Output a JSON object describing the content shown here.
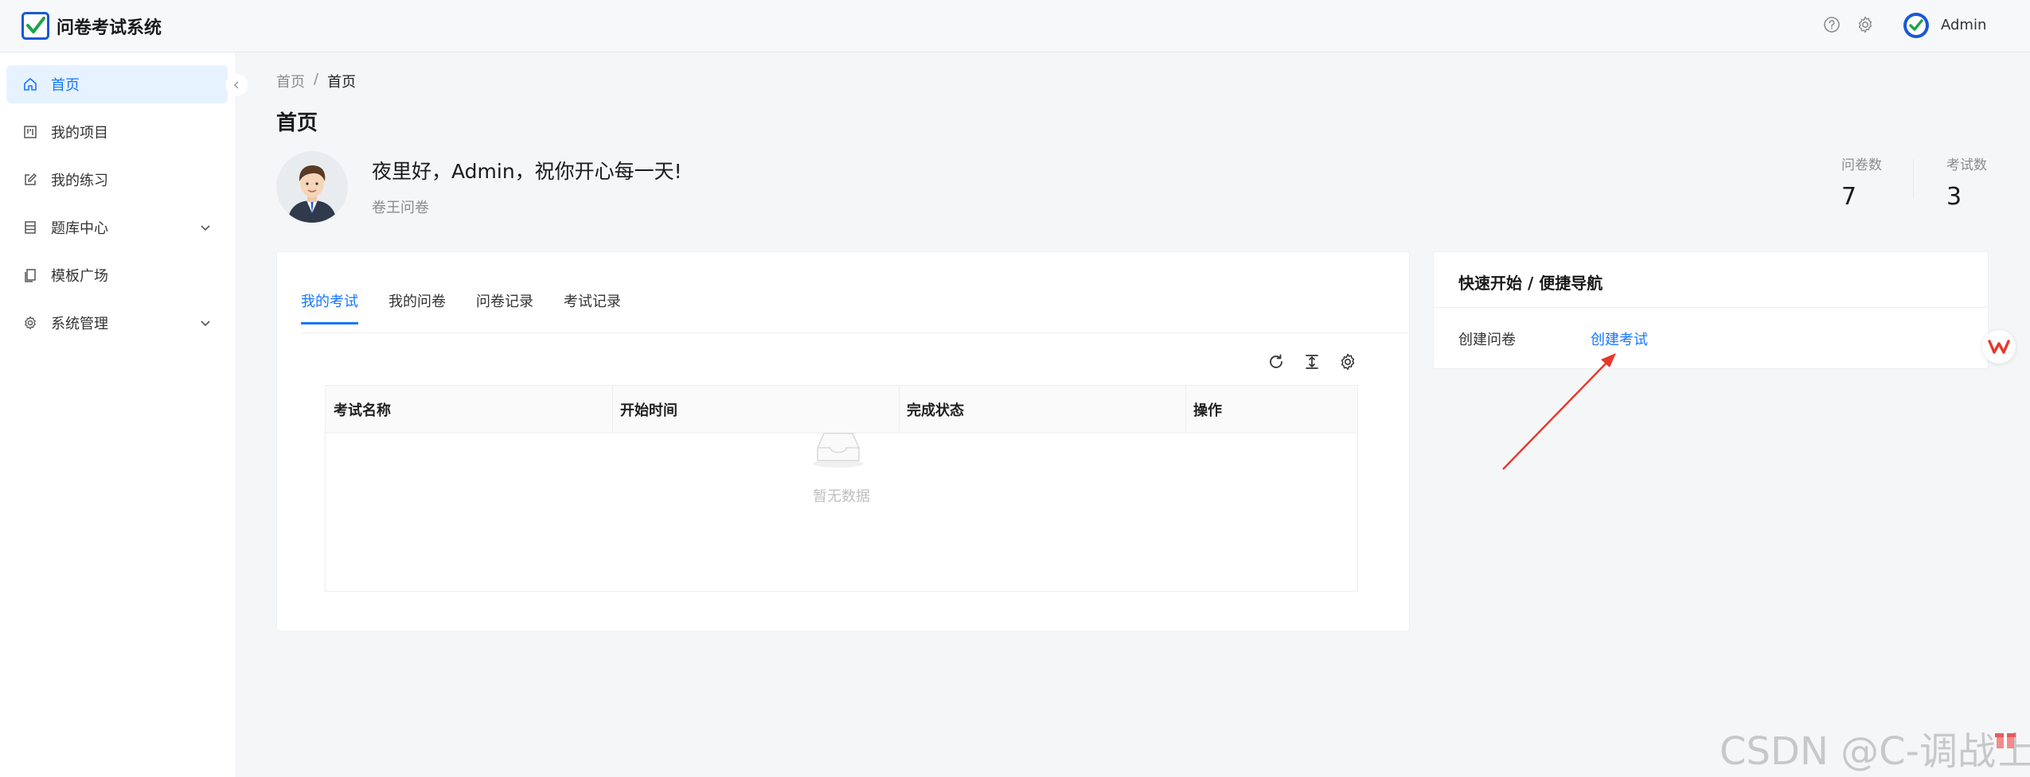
{
  "app": {
    "title": "问卷考试系统",
    "user": "Admin"
  },
  "sidebar": {
    "items": [
      {
        "label": "首页",
        "icon": "home-icon",
        "active": true
      },
      {
        "label": "我的项目",
        "icon": "project-icon"
      },
      {
        "label": "我的练习",
        "icon": "edit-icon"
      },
      {
        "label": "题库中心",
        "icon": "list-icon",
        "has_children": true
      },
      {
        "label": "模板广场",
        "icon": "copy-icon"
      },
      {
        "label": "系统管理",
        "icon": "gear-icon",
        "has_children": true
      }
    ]
  },
  "breadcrumb": {
    "root": "首页",
    "separator": "/",
    "current": "首页"
  },
  "page": {
    "title": "首页"
  },
  "welcome": {
    "greeting": "夜里好，Admin，祝你开心每一天!",
    "subtitle": "卷王问卷"
  },
  "stats": [
    {
      "label": "问卷数",
      "value": "7"
    },
    {
      "label": "考试数",
      "value": "3"
    }
  ],
  "tabs": [
    {
      "label": "我的考试",
      "active": true
    },
    {
      "label": "我的问卷"
    },
    {
      "label": "问卷记录"
    },
    {
      "label": "考试记录"
    }
  ],
  "table": {
    "columns": [
      "考试名称",
      "开始时间",
      "完成状态",
      "操作"
    ],
    "rows": [],
    "empty_text": "暂无数据"
  },
  "quick_nav": {
    "title": "快速开始 / 便捷导航",
    "links": [
      "创建问卷",
      "创建考试"
    ]
  },
  "watermark": "CSDN @C-调战士",
  "colors": {
    "primary": "#1677ff",
    "annotation_arrow": "#e8372b"
  }
}
